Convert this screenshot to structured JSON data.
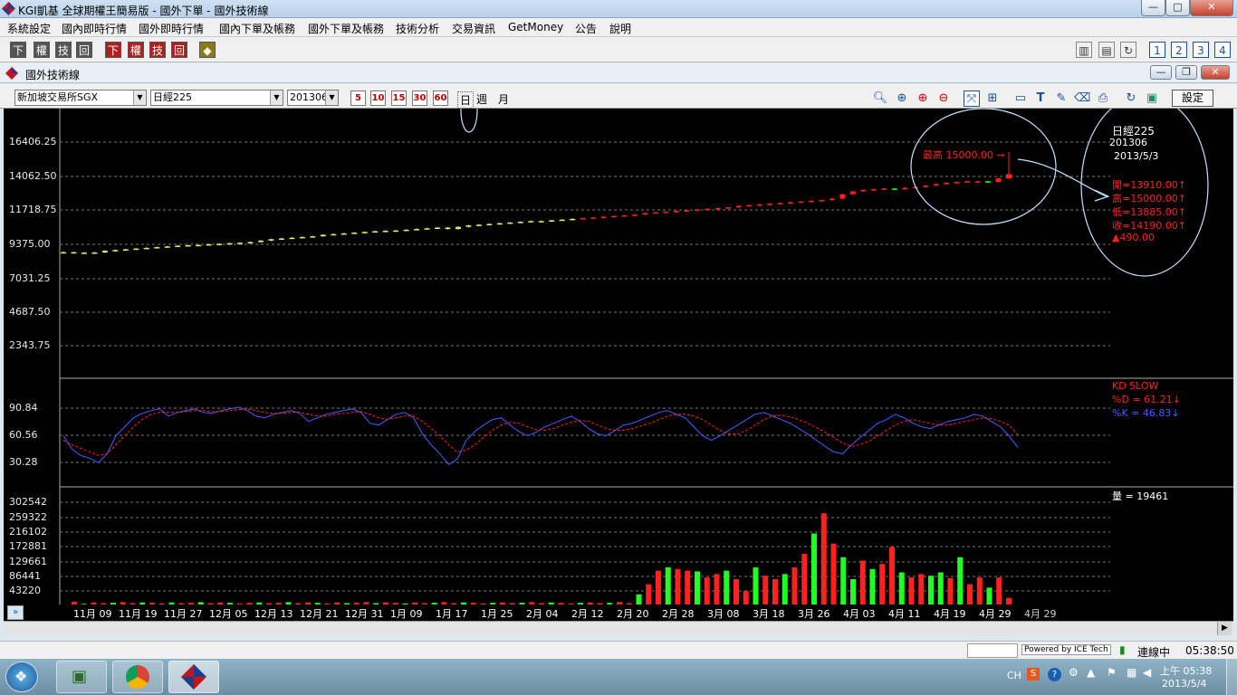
{
  "window": {
    "title": "KGI凱基 全球期權王簡易版 - 國外下單 - 國外技術線",
    "buttons": [
      "—",
      "□",
      "✕"
    ]
  },
  "menu": [
    "系統設定",
    "國內即時行情",
    "國外即時行情",
    "國內下單及帳務",
    "國外下單及帳務",
    "技術分析",
    "交易資訊",
    "GetMoney",
    "公告",
    "說明"
  ],
  "toolbar": {
    "left_buttons": [
      "下",
      "權",
      "技",
      "回",
      "下",
      "權",
      "技",
      "回"
    ],
    "right_numbers": [
      "1",
      "2",
      "3",
      "4"
    ]
  },
  "inner_window": {
    "title": "國外技術線",
    "exchange": "新加坡交易所SGX",
    "product": "日經225",
    "contract": "201306",
    "periods": [
      "5",
      "10",
      "15",
      "30",
      "60"
    ],
    "day_label": "日",
    "week_label": "週",
    "month_label": "月",
    "settings_label": "設定"
  },
  "chart_data": {
    "type": "candlestick",
    "price_axis": [
      "16406.25",
      "14062.50",
      "11718.75",
      "9375.00",
      "7031.25",
      "4687.50",
      "2343.75"
    ],
    "kd_axis": [
      "90.84",
      "60.56",
      "30.28"
    ],
    "volume_axis": [
      "302542",
      "259322",
      "216102",
      "172881",
      "129661",
      "86441",
      "43220"
    ],
    "x_labels": [
      "11月 09",
      "11月 19",
      "11月 27",
      "12月 05",
      "12月 13",
      "12月 21",
      "12月 31",
      "1月 09",
      "1月 17",
      "1月 25",
      "2月 04",
      "2月 12",
      "2月 20",
      "2月 28",
      "3月 08",
      "3月 18",
      "3月 26",
      "4月 03",
      "4月 11",
      "4月 19",
      "4月 29",
      "4月 29"
    ],
    "high_marker": "最高 15000.00 →",
    "info": {
      "name": "日經225",
      "contract": "201306",
      "date": "2013/5/3",
      "open": "開=13910.00↑",
      "high": "高=15000.00↑",
      "low": "低=13885.00↑",
      "close": "收=14190.00↑",
      "change": "▲490.00"
    },
    "kd": {
      "title": "KD SLOW",
      "d": "%D = 61.21↓",
      "k": "%K = 46.83↓"
    },
    "volume_label": "量 = 19461",
    "closes": [
      8800,
      8760,
      8770,
      8780,
      8900,
      8950,
      9000,
      9050,
      9100,
      9150,
      9200,
      9250,
      9280,
      9300,
      9350,
      9380,
      9420,
      9450,
      9500,
      9600,
      9700,
      9750,
      9800,
      9850,
      9900,
      10000,
      10050,
      10100,
      10150,
      10200,
      10250,
      10280,
      10300,
      10350,
      10400,
      10450,
      10500,
      10400,
      10550,
      10650,
      10700,
      10750,
      10800,
      10850,
      10900,
      10950,
      10950,
      11000,
      11050,
      11100,
      11150,
      11200,
      11250,
      11300,
      11350,
      11400,
      11500,
      11550,
      11600,
      11650,
      11700,
      11750,
      11800,
      11850,
      11900,
      12000,
      12050,
      12100,
      12150,
      12200,
      12250,
      12300,
      12350,
      12400,
      12500,
      12800,
      13000,
      13100,
      13150,
      13200,
      13150,
      13250,
      13300,
      13400,
      13500,
      13600,
      13650,
      13700,
      13700,
      13650,
      13900,
      14190
    ],
    "volumes": [
      8000,
      2000,
      6000,
      4000,
      5000,
      7000,
      4000,
      6000,
      5000,
      3000,
      6000,
      4000,
      5000,
      7000,
      4000,
      6000,
      5000,
      3000,
      5000,
      6000,
      4000,
      5000,
      7000,
      4000,
      6000,
      5000,
      3000,
      6000,
      4000,
      5000,
      7000,
      4000,
      6000,
      5000,
      3000,
      6000,
      4000,
      5000,
      7000,
      4000,
      6000,
      5000,
      3000,
      5000,
      6000,
      4000,
      5000,
      7000,
      4000,
      6000,
      5000,
      3000,
      5000,
      6000,
      4000,
      5000,
      7000,
      4000,
      30000,
      60000,
      100000,
      110000,
      105000,
      100000,
      98000,
      80000,
      90000,
      100000,
      75000,
      40000,
      110000,
      85000,
      75000,
      90000,
      110000,
      150000,
      210000,
      270000,
      180000,
      140000,
      75000,
      130000,
      105000,
      120000,
      170000,
      95000,
      80000,
      90000,
      85000,
      95000,
      78000,
      140000,
      60000,
      80000,
      50000,
      80000,
      19461
    ],
    "k_values": [
      60,
      45,
      38,
      35,
      30,
      40,
      60,
      70,
      80,
      85,
      88,
      90,
      82,
      86,
      88,
      90,
      86,
      85,
      88,
      90,
      92,
      88,
      82,
      80,
      84,
      86,
      88,
      85,
      76,
      80,
      84,
      86,
      88,
      90,
      86,
      74,
      72,
      78,
      84,
      86,
      80,
      62,
      50,
      40,
      28,
      34,
      55,
      65,
      72,
      78,
      80,
      72,
      65,
      60,
      64,
      70,
      74,
      78,
      82,
      76,
      68,
      62,
      60,
      66,
      72,
      74,
      78,
      82,
      86,
      88,
      84,
      80,
      70,
      60,
      55,
      60,
      66,
      72,
      78,
      84,
      86,
      82,
      78,
      74,
      68,
      62,
      55,
      48,
      42,
      40,
      50,
      58,
      66,
      74,
      78,
      84,
      80,
      74,
      70,
      68,
      72,
      76,
      78,
      80,
      84,
      82,
      76,
      70,
      60,
      46.83
    ],
    "d_values": [
      55,
      50,
      46,
      42,
      38,
      40,
      50,
      60,
      70,
      78,
      84,
      86,
      86,
      86,
      87,
      88,
      88,
      87,
      87,
      88,
      89,
      90,
      88,
      86,
      85,
      85,
      86,
      86,
      84,
      82,
      82,
      84,
      85,
      86,
      87,
      84,
      80,
      78,
      80,
      82,
      82,
      76,
      68,
      60,
      50,
      42,
      44,
      50,
      58,
      66,
      72,
      75,
      74,
      70,
      67,
      66,
      68,
      72,
      75,
      77,
      76,
      72,
      68,
      66,
      66,
      68,
      71,
      74,
      78,
      82,
      84,
      84,
      82,
      78,
      72,
      66,
      62,
      62,
      66,
      72,
      78,
      82,
      83,
      81,
      78,
      74,
      69,
      64,
      58,
      52,
      48,
      50,
      54,
      60,
      66,
      72,
      76,
      78,
      76,
      74,
      72,
      72,
      74,
      76,
      78,
      80,
      79,
      76,
      72,
      61.21
    ]
  },
  "status": {
    "powered": "Powered by ICE Tech",
    "connection": "連線中",
    "time": "05:38:50"
  },
  "taskbar": {
    "lang": "CH",
    "clock_time": "上午 05:38",
    "clock_date": "2013/5/4"
  }
}
